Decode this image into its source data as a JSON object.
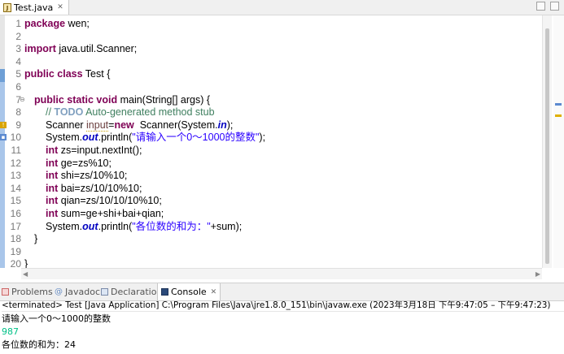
{
  "editor": {
    "tab_label": "Test.java",
    "tab_close": "✕",
    "lines": [
      "1",
      "2",
      "3",
      "4",
      "5",
      "6",
      "7",
      "8",
      "9",
      "10",
      "11",
      "12",
      "13",
      "14",
      "15",
      "16",
      "17",
      "18",
      "19",
      "20"
    ]
  },
  "code": {
    "l1_kw": "package",
    "l1_rest": " wen;",
    "l3_kw": "import",
    "l3_rest": " java.util.Scanner;",
    "l5_kw": "public class",
    "l5_rest": " Test {",
    "l7_kw": "public static void",
    "l7_rest": " main(String[] args) {",
    "l8_comment": "// ",
    "l8_todo": "TODO",
    "l8_rest": " Auto-generated method stub",
    "l9_a": "Scanner ",
    "l9_var": "input",
    "l9_b": "=",
    "l9_kw": "new",
    "l9_c": "  Scanner(System.",
    "l9_fld": "in",
    "l9_d": ");",
    "l10_a": "System.",
    "l10_fld": "out",
    "l10_b": ".println(",
    "l10_str": "\"请输入一个0～1000的整数\"",
    "l10_c": ");",
    "l11_kw": "int",
    "l11_rest": " zs=input.nextInt();",
    "l12_kw": "int",
    "l12_rest": " ge=zs%10;",
    "l13_kw": "int",
    "l13_rest": " shi=zs/10%10;",
    "l14_kw": "int",
    "l14_rest": " bai=zs/10/10%10;",
    "l15_kw": "int",
    "l15_rest": " qian=zs/10/10/10%10;",
    "l16_kw": "int",
    "l16_rest": " sum=ge+shi+bai+qian;",
    "l17_a": "System.",
    "l17_fld": "out",
    "l17_b": ".println(",
    "l17_str": "\"各位数的和为：\"",
    "l17_c": "+sum);",
    "l18": "}",
    "l20": "}"
  },
  "console_tabs": {
    "problems": "Problems",
    "javadoc": "Javadoc",
    "declaration": "Declaration",
    "console": "Console",
    "console_close": "✕"
  },
  "console": {
    "terminated": "<terminated> Test [Java Application] C:\\Program Files\\Java\\jre1.8.0_151\\bin\\javaw.exe  (2023年3月18日 下午9:47:05 – 下午9:47:23)",
    "line1": "请输入一个0～1000的整数",
    "input": "987",
    "line3": "各位数的和为：24"
  },
  "colors": {
    "keyword": "#7f0055",
    "comment": "#3f7f5f",
    "string": "#2a00ff",
    "field": "#0000c0",
    "console_input": "#00c087"
  }
}
